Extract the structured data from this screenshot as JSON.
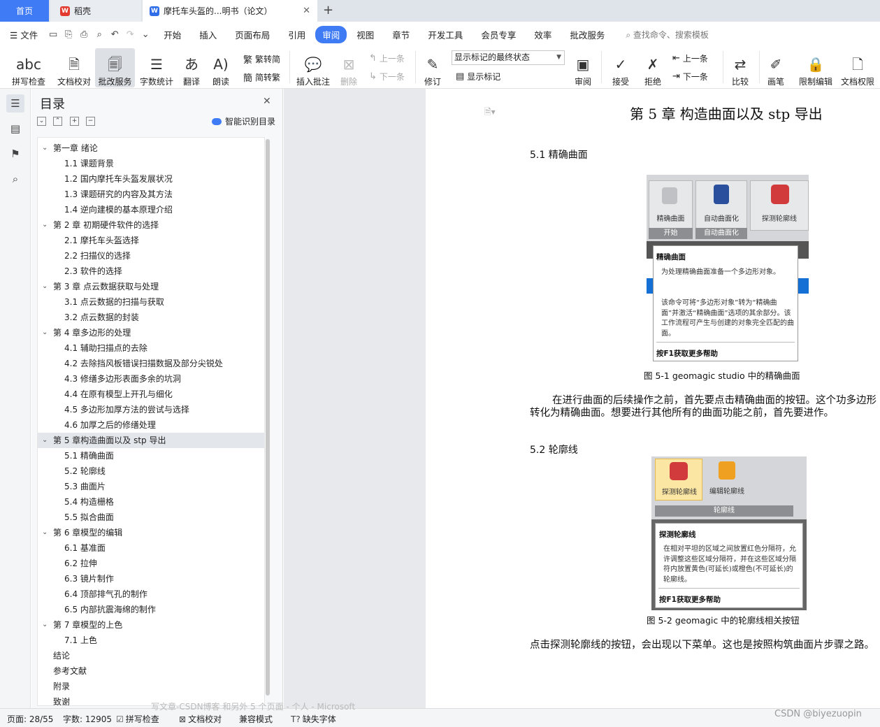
{
  "tabs": {
    "home": "首页",
    "docer": "稻壳",
    "doc": "摩托车头盔的...明书（论文）",
    "add": "+"
  },
  "menu": {
    "file": "文件",
    "items": [
      "开始",
      "插入",
      "页面布局",
      "引用",
      "审阅",
      "视图",
      "章节",
      "开发工具",
      "会员专享",
      "效率",
      "批改服务"
    ],
    "search": "查找命令、搜索模板"
  },
  "ribbon": {
    "spell_check": "拼写检查",
    "doc_check": "文档校对",
    "correction": "批改服务",
    "word_count": "字数统计",
    "translate": "翻译",
    "read_aloud": "朗读",
    "trad_to_simp": "繁转简",
    "simp_to_trad": "简转繁",
    "insert_comment": "插入批注",
    "delete": "删除",
    "prev_comment": "上一条",
    "next_comment": "下一条",
    "revise": "修订",
    "markup_state": "显示标记的最终状态",
    "show_markup": "显示标记",
    "review": "审阅",
    "accept": "接受",
    "reject": "拒绝",
    "prev_change": "上一条",
    "next_change": "下一条",
    "compare": "比较",
    "pen": "画笔",
    "restrict_edit": "限制编辑",
    "doc_permission": "文档权限"
  },
  "toc": {
    "title": "目录",
    "smart": "智能识别目录",
    "items": [
      {
        "level": 1,
        "text": "第一章  绪论",
        "expanded": true
      },
      {
        "level": 2,
        "text": "1.1 课题背景"
      },
      {
        "level": 2,
        "text": "1.2 国内摩托车头盔发展状况"
      },
      {
        "level": 2,
        "text": "1.3 课题研究的内容及其方法"
      },
      {
        "level": 2,
        "text": "1.4 逆向建模的基本原理介绍"
      },
      {
        "level": 1,
        "text": "第 2 章  初期硬件软件的选择",
        "expanded": true
      },
      {
        "level": 2,
        "text": "2.1 摩托车头盔选择"
      },
      {
        "level": 2,
        "text": "2.2 扫描仪的选择"
      },
      {
        "level": 2,
        "text": "2.3  软件的选择"
      },
      {
        "level": 1,
        "text": "第 3 章    点云数据获取与处理",
        "expanded": true
      },
      {
        "level": 2,
        "text": "3.1  点云数据的扫描与获取"
      },
      {
        "level": 2,
        "text": "3.2  点云数据的封装"
      },
      {
        "level": 1,
        "text": "第 4 章多边形的处理",
        "expanded": true
      },
      {
        "level": 2,
        "text": "4.1  辅助扫描点的去除"
      },
      {
        "level": 2,
        "text": "4.2  去除挡风板错误扫描数据及部分尖锐处"
      },
      {
        "level": 2,
        "text": "4.3  修缮多边形表面多余的坑洞"
      },
      {
        "level": 2,
        "text": "4.4  在原有模型上开孔与细化"
      },
      {
        "level": 2,
        "text": "4.5  多边形加厚方法的尝试与选择"
      },
      {
        "level": 2,
        "text": "4.6  加厚之后的修缮处理"
      },
      {
        "level": 1,
        "text": "第 5 章构造曲面以及 stp 导出",
        "expanded": true,
        "selected": true
      },
      {
        "level": 2,
        "text": "5.1  精确曲面"
      },
      {
        "level": 2,
        "text": "5.2  轮廓线"
      },
      {
        "level": 2,
        "text": "5.3  曲面片"
      },
      {
        "level": 2,
        "text": "5.4  构造栅格"
      },
      {
        "level": 2,
        "text": "5.5  拟合曲面"
      },
      {
        "level": 1,
        "text": "第 6 章模型的编辑",
        "expanded": true
      },
      {
        "level": 2,
        "text": "6.1  基准面"
      },
      {
        "level": 2,
        "text": "6.2  拉伸"
      },
      {
        "level": 2,
        "text": "6.3  镜片制作"
      },
      {
        "level": 2,
        "text": "6.4  顶部排气孔的制作"
      },
      {
        "level": 2,
        "text": "6.5  内部抗震海绵的制作"
      },
      {
        "level": 1,
        "text": "第 7 章模型的上色",
        "expanded": true
      },
      {
        "level": 2,
        "text": "7.1  上色"
      },
      {
        "level": 1,
        "text": "结论"
      },
      {
        "level": 1,
        "text": "参考文献"
      },
      {
        "level": 1,
        "text": "附录"
      },
      {
        "level": 1,
        "text": "致谢"
      }
    ]
  },
  "document": {
    "chapter_title": "第 5 章  构造曲面以及 stp 导出",
    "sec1_title": "5.1  精确曲面",
    "fig1": {
      "btn1": "精确曲面",
      "btn2": "自动曲面化",
      "btn3": "探测轮廓线",
      "grp1": "开始",
      "grp2": "自动曲面化",
      "tooltip_title": "精确曲面",
      "tooltip_body1": "为处理精确曲面准备一个多边形对象。",
      "tooltip_body2": "该命令可将“多边形对象”转为“精确曲面”并激活“精确曲面”选项的其余部分。该工作流程可产生与创建的对象完全匹配的曲面。",
      "tooltip_help": "按F1获取更多帮助",
      "caption": "图 5-1 geomagic studio 中的精确曲面"
    },
    "para1": "在进行曲面的后续操作之前，首先要点击精确曲面的按钮。这个功多边形转化为精确曲面。想要进行其他所有的曲面功能之前，首先要进作。",
    "sec2_title": "5.2  轮廓线",
    "fig2": {
      "btn1": "探测轮廓线",
      "btn2": "编辑轮廓线",
      "grp": "轮廓线",
      "tooltip_title": "探测轮廓线",
      "tooltip_body": "在相对平坦的区域之间放置红色分隔符，允许调整这些区域分隔符，并在这些区域分隔符内放置黄色(可延长)或橙色(不可延长)的轮廓线。",
      "tooltip_help": "按F1获取更多帮助",
      "caption": "图 5-2 geomagic 中的轮廓线相关按钮"
    },
    "para2": "点击探测轮廓线的按钮，会出现以下菜单。这也是按照构筑曲面片步骤之路。"
  },
  "status": {
    "page": "页面: 28/55",
    "words": "字数: 12905",
    "spell": "拼写检查",
    "doc_check": "文档校对",
    "compat": "兼容模式",
    "missing_font": "缺失字体",
    "ghost": "写文章-CSDN博客 和另外 5 个页面 - 个人 - Microsoft"
  },
  "watermark": "CSDN @biyezuopin",
  "colors": {
    "accent": "#3f7bf5",
    "tab_bg": "#dfe3ea",
    "selected_row": "#e3e6eb"
  }
}
